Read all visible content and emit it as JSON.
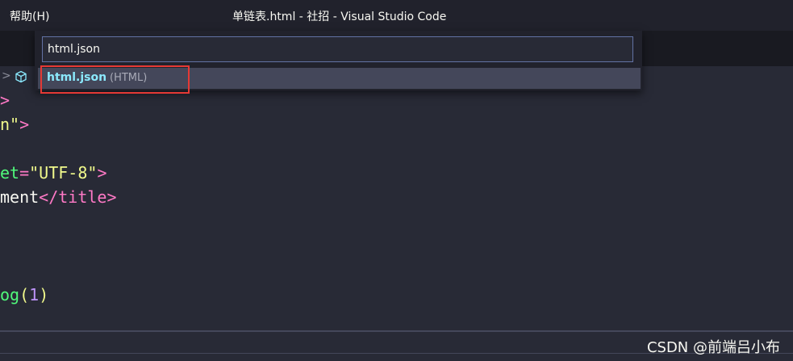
{
  "titlebar": {
    "menu_help": "帮助(H)",
    "window_title": "单链表.html - 社招 - Visual Studio Code"
  },
  "breadcrumb": {
    "chevron": ">"
  },
  "editor": {
    "line1": ">",
    "line2_str": "n\"",
    "line2_end": ">",
    "line3_attr": "et",
    "line3_eq": "=",
    "line3_str": "\"UTF-8\"",
    "line3_end": ">",
    "line4_text": "ment",
    "line4_open": "</",
    "line4_tag": "title",
    "line4_end": ">",
    "line5_fn": "og",
    "line5_open": "(",
    "line5_num": "1",
    "line5_close": ")"
  },
  "quick_open": {
    "input_value": "html.json",
    "result_label": "html.json",
    "result_detail": "(HTML)"
  },
  "watermark": "CSDN @前端吕小布"
}
